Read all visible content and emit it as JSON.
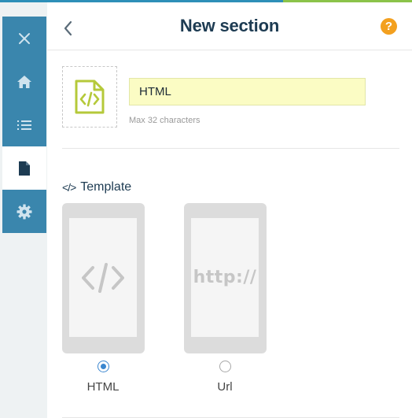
{
  "header": {
    "title": "New section",
    "help_symbol": "?"
  },
  "sidebar": {
    "items": [
      {
        "icon": "close-icon",
        "active": false
      },
      {
        "icon": "home-icon",
        "active": false
      },
      {
        "icon": "list-icon",
        "active": false
      },
      {
        "icon": "document-icon",
        "active": true
      },
      {
        "icon": "gear-icon",
        "active": false
      }
    ]
  },
  "form": {
    "name_value": "HTML",
    "name_hint": "Max 32 characters"
  },
  "template": {
    "section_title": "Template",
    "section_glyph": "</>",
    "options": [
      {
        "label": "HTML",
        "preview": "</>",
        "selected": true
      },
      {
        "label": "Url",
        "preview": "http://",
        "selected": false
      }
    ]
  },
  "colors": {
    "sidebar": "#3a86ad",
    "title": "#1d3b52",
    "accent_orange": "#f3a01f",
    "input_bg": "#fbfcc4",
    "radio_selected": "#3a86cf",
    "icon_green": "#b5c93a"
  }
}
